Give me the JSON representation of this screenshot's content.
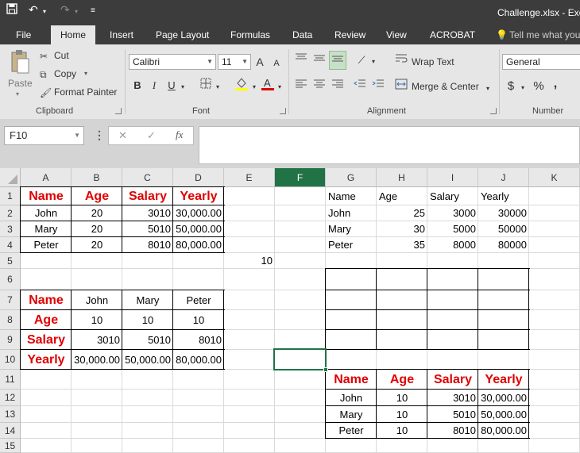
{
  "window": {
    "title": "Challenge.xlsx - Exce"
  },
  "tabs": [
    {
      "label": "File"
    },
    {
      "label": "Home"
    },
    {
      "label": "Insert"
    },
    {
      "label": "Page Layout"
    },
    {
      "label": "Formulas"
    },
    {
      "label": "Data"
    },
    {
      "label": "Review"
    },
    {
      "label": "View"
    },
    {
      "label": "ACROBAT"
    }
  ],
  "tell_me": "Tell me what you",
  "ribbon": {
    "clipboard": {
      "paste": "Paste",
      "cut": "Cut",
      "copy": "Copy",
      "format_painter": "Format Painter",
      "label": "Clipboard"
    },
    "font": {
      "name": "Calibri",
      "size": "11",
      "bold": "B",
      "italic": "I",
      "underline": "U",
      "grow": "A",
      "shrink": "A",
      "label": "Font"
    },
    "alignment": {
      "wrap": "Wrap Text",
      "merge": "Merge & Center",
      "label": "Alignment"
    },
    "number": {
      "format": "General",
      "currency": "$",
      "percent": "%",
      "comma": ",",
      "label": "Number"
    }
  },
  "formula_bar": {
    "name_box": "F10",
    "fx": "fx",
    "cancel": "✕",
    "enter": "✓",
    "formula": ""
  },
  "grid": {
    "columns": [
      "A",
      "B",
      "C",
      "D",
      "E",
      "F",
      "G",
      "H",
      "I",
      "J",
      "K"
    ],
    "selected_column": "F",
    "rows": [
      "1",
      "2",
      "3",
      "4",
      "5",
      "6",
      "7",
      "8",
      "9",
      "10",
      "11",
      "12",
      "13",
      "14",
      "15"
    ],
    "cells": {
      "A1": "Name",
      "B1": "Age",
      "C1": "Salary",
      "D1": "Yearly",
      "A2": "John",
      "B2": "20",
      "C2": "3010",
      "D2": "30,000.00",
      "A3": "Mary",
      "B3": "20",
      "C3": "5010",
      "D3": "50,000.00",
      "A4": "Peter",
      "B4": "20",
      "C4": "8010",
      "D4": "80,000.00",
      "E5": "10",
      "A7": "Name",
      "B7": "John",
      "C7": "Mary",
      "D7": "Peter",
      "A8": "Age",
      "B8": "10",
      "C8": "10",
      "D8": "10",
      "A9": "Salary",
      "B9": "3010",
      "C9": "5010",
      "D9": "8010",
      "A10": "Yearly",
      "B10": "30,000.00",
      "C10": "50,000.00",
      "D10": "80,000.00",
      "G1": "Name",
      "H1": "Age",
      "I1": "Salary",
      "J1": "Yearly",
      "G2": "John",
      "H2": "25",
      "I2": "3000",
      "J2": "30000",
      "G3": "Mary",
      "H3": "30",
      "I3": "5000",
      "J3": "50000",
      "G4": "Peter",
      "H4": "35",
      "I4": "8000",
      "J4": "80000",
      "G11": "Name",
      "H11": "Age",
      "I11": "Salary",
      "J11": "Yearly",
      "G12": "John",
      "H12": "10",
      "I12": "3010",
      "J12": "30,000.00",
      "G13": "Mary",
      "H13": "10",
      "I13": "5010",
      "J13": "50,000.00",
      "G14": "Peter",
      "H14": "10",
      "I14": "8010",
      "J14": "80,000.00"
    },
    "active_cell": "F10"
  },
  "colors": {
    "title_bar": "#3c3c3c",
    "ribbon": "#e6e6e6",
    "header_red": "#e00000",
    "excel_green": "#217346"
  }
}
